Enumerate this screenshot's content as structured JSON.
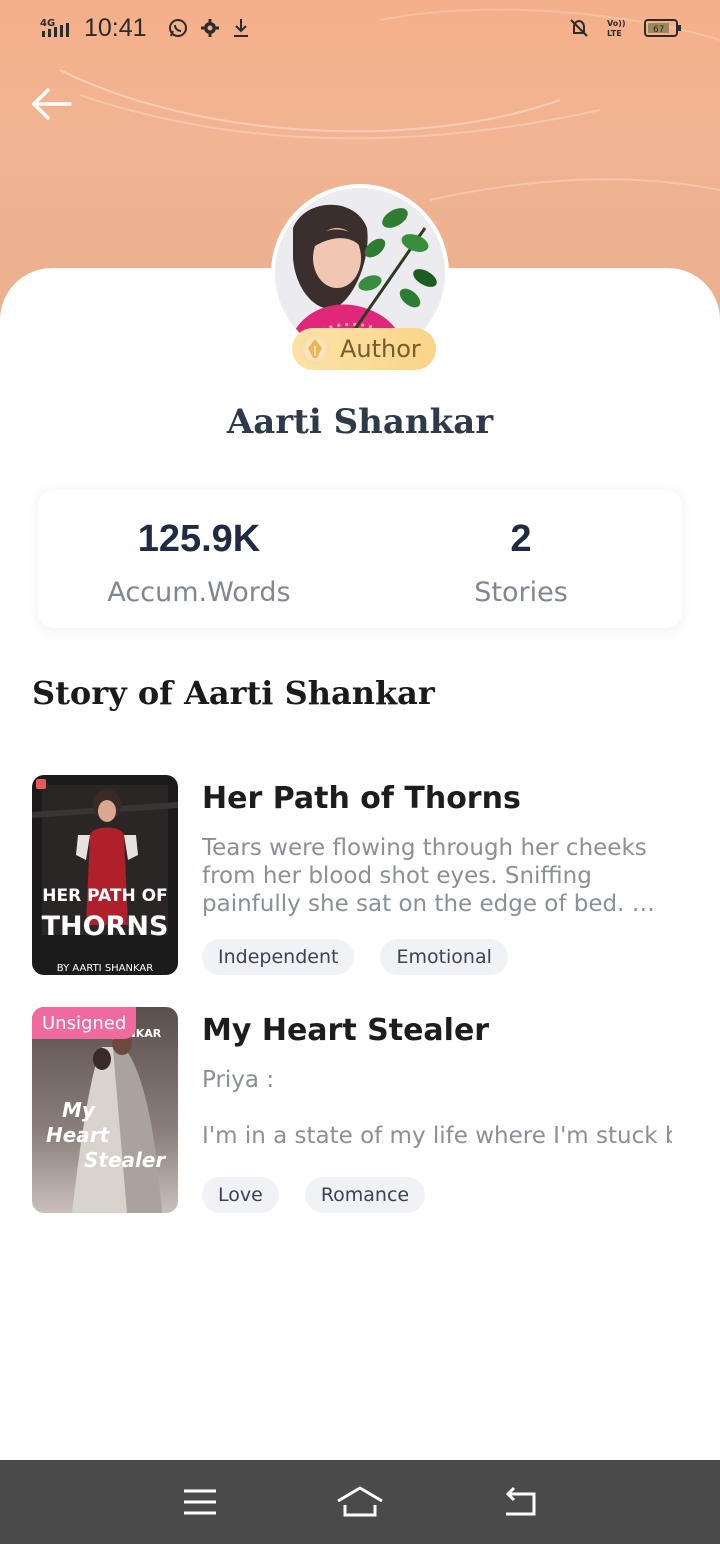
{
  "status_bar": {
    "network": "4G",
    "time": "10:41",
    "left_icons": [
      "whatsapp-icon",
      "gear-icon",
      "download-icon"
    ],
    "right_icons": [
      "bell-off-icon",
      "volte-icon",
      "battery-icon"
    ],
    "volte": "Vo LTE",
    "battery_level": "67"
  },
  "header": {
    "back_icon": "arrow-left-icon",
    "badge_label": "Author"
  },
  "profile": {
    "name": "Aarti Shankar"
  },
  "stats": [
    {
      "value": "125.9K",
      "label": "Accum.Words"
    },
    {
      "value": "2",
      "label": "Stories"
    }
  ],
  "section": {
    "title": "Story of Aarti Shankar"
  },
  "books": [
    {
      "title": "Her Path of Thorns",
      "description": "Tears were flowing through her cheeks from her blood shot eyes. Sniffing painfully she sat on the edge of bed.  …",
      "tags": [
        "Independent",
        "Emotional"
      ],
      "cover": {
        "line1": "HER PATH OF",
        "line2": "THORNS",
        "byline": "BY AARTI SHANKAR"
      }
    },
    {
      "title": "My Heart Stealer",
      "description_line1": "Priya :",
      "description_line2": "I'm in a state of my life where I'm stuck bet…",
      "tags": [
        "Love",
        "Romance"
      ],
      "unsigned_label": "Unsigned",
      "cover": {
        "author": "ANKAR",
        "line1": "My",
        "line2": "Heart",
        "line3": "Stealer"
      }
    }
  ],
  "navbar": {
    "icons": [
      "menu-icon",
      "home-icon",
      "back-icon"
    ]
  },
  "colors": {
    "header_gradient_top": "#f4b08a",
    "badge": "#f9d58a",
    "unsigned": "#f06aa0",
    "navbar": "#4a4a4a"
  }
}
